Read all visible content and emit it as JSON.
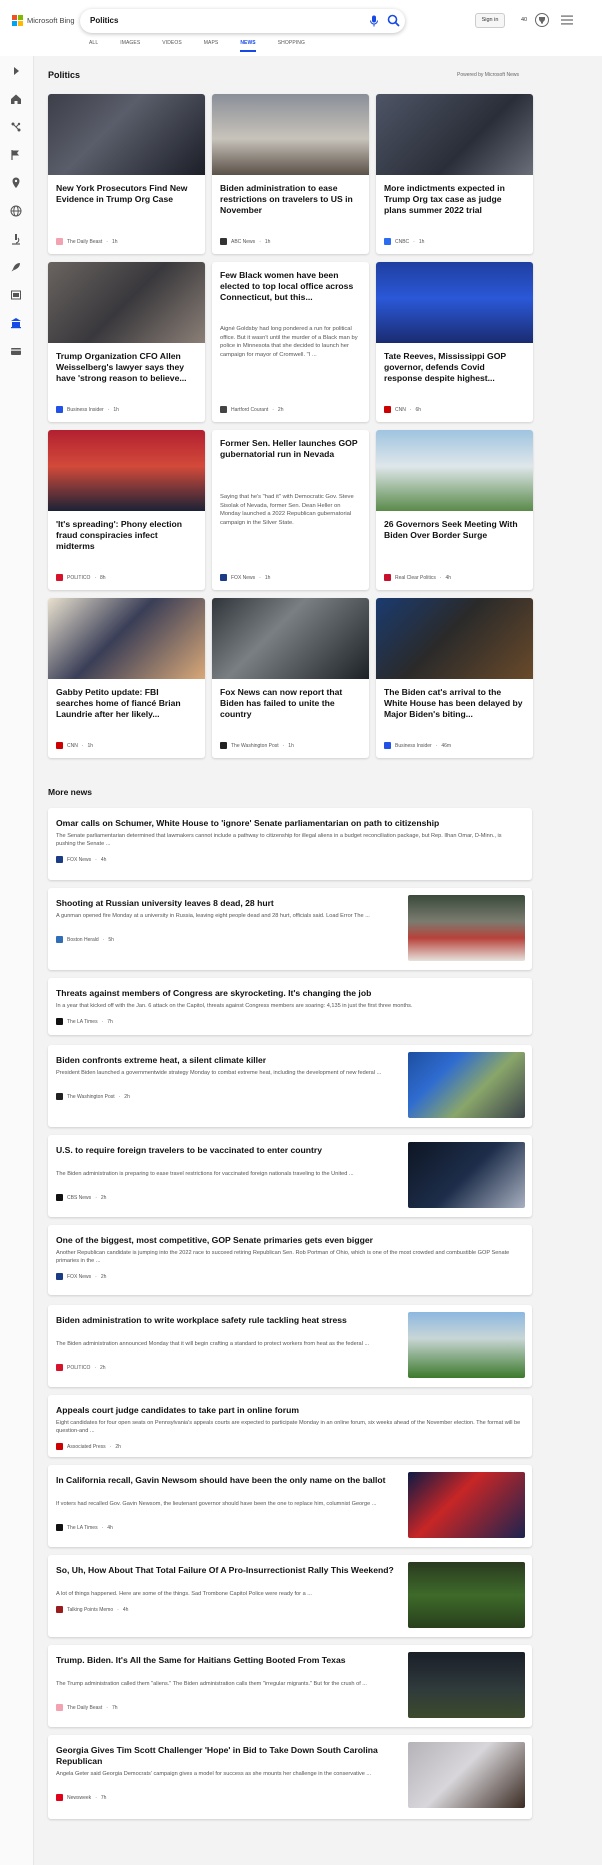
{
  "header": {
    "logo_text": "Microsoft Bing",
    "search_value": "Politics",
    "signin_label": "Sign in",
    "rewards_count": "40",
    "tabs": [
      {
        "label": "ALL"
      },
      {
        "label": "IMAGES"
      },
      {
        "label": "VIDEOS"
      },
      {
        "label": "MAPS"
      },
      {
        "label": "NEWS",
        "active": true
      },
      {
        "label": "SHOPPING"
      }
    ]
  },
  "sidebar": {
    "icons": [
      "expand-arrow-icon",
      "home-icon",
      "science-icon",
      "flag-icon",
      "location-pin-icon",
      "globe-icon",
      "microscope-icon",
      "rocket-icon",
      "film-icon",
      "building-icon",
      "card-icon"
    ]
  },
  "main": {
    "section_title": "Politics",
    "powered_by": "Powered by Microsoft News",
    "cards": [
      {
        "title": "New York Prosecutors Find New Evidence in Trump Org Case",
        "source": "The Daily Beast",
        "time": "1h"
      },
      {
        "title": "Biden administration to ease restrictions on travelers to US in November",
        "source": "ABC News",
        "time": "1h"
      },
      {
        "title": "More indictments expected in Trump Org tax case as judge plans summer 2022 trial",
        "source": "CNBC",
        "time": "1h"
      },
      {
        "title": "Trump Organization CFO Allen Weisselberg's lawyer says they have 'strong reason to believe...",
        "source": "Business Insider",
        "time": "1h"
      },
      {
        "title": "Few Black women have been elected to top local office across Connecticut, but this...",
        "snippet": "Aigné Goldsby had long pondered a run for political office. But it wasn't until the murder of a Black man by police in Minnesota that she decided to launch her campaign for mayor of Cromwell. \"I ...",
        "source": "Hartford Courant",
        "time": "2h"
      },
      {
        "title": "Tate Reeves, Mississippi GOP governor, defends Covid response despite highest...",
        "source": "CNN",
        "time": "6h"
      },
      {
        "title": "'It's spreading': Phony election fraud conspiracies infect midterms",
        "source": "POLITICO",
        "time": "8h"
      },
      {
        "title": "Former Sen. Heller launches GOP gubernatorial run in Nevada",
        "snippet": "Saying that he's \"had it\" with Democratic Gov. Steve Sisolak of Nevada, former Sen. Dean Heller on Monday launched a 2022 Republican gubernatorial campaign in the Silver State.",
        "source": "FOX News",
        "time": "1h"
      },
      {
        "title": "26 Governors Seek Meeting With Biden Over Border Surge",
        "source": "Real Clear Politics",
        "time": "4h"
      },
      {
        "title": "Gabby Petito update: FBI searches home of fiancé Brian Laundrie after her likely...",
        "source": "CNN",
        "time": "1h"
      },
      {
        "title": "Fox News can now report that Biden has failed to unite the country",
        "source": "The Washington Post",
        "time": "1h"
      },
      {
        "title": "The Biden cat's arrival to the White House has been delayed by Major Biden's biting...",
        "source": "Business Insider",
        "time": "46m"
      }
    ],
    "more_title": "More news",
    "more_news": [
      {
        "title": "Omar calls on Schumer, White House to 'ignore' Senate parliamentarian on path to citizenship",
        "snippet": "The Senate parliamentarian determined that lawmakers cannot include a pathway to citizenship for illegal aliens in a budget reconciliation package, but Rep. Ilhan Omar, D-Minn., is pushing the Senate ...",
        "source": "FOX News",
        "time": "4h"
      },
      {
        "title": "Shooting at Russian university leaves 8 dead, 28 hurt",
        "snippet": "A gunman opened fire Monday at a university in Russia, leaving eight people dead and 28 hurt, officials said. Load Error The ...",
        "source": "Boston Herald",
        "time": "5h"
      },
      {
        "title": "Threats against members of Congress are skyrocketing. It's changing the job",
        "snippet": "In a year that kicked off with the Jan. 6 attack on the Capitol, threats against Congress members are soaring: 4,135 in just the first three months.",
        "source": "The LA Times",
        "time": "7h"
      },
      {
        "title": "Biden confronts extreme heat, a silent climate killer",
        "snippet": "President Biden launched a governmentwide strategy Monday to combat extreme heat, including the development of new federal ...",
        "source": "The Washington Post",
        "time": "2h"
      },
      {
        "title": "U.S. to require foreign travelers to be vaccinated to enter country",
        "snippet": "The Biden administration is preparing to ease travel restrictions for vaccinated foreign nationals traveling to the United ...",
        "source": "CBS News",
        "time": "2h"
      },
      {
        "title": "One of the biggest, most competitive, GOP Senate primaries gets even bigger",
        "snippet": "Another Republican candidate is jumping into the 2022 race to succeed retiring Republican Sen. Rob Portman of Ohio, which is one of the most crowded and combustible GOP Senate primaries in the ...",
        "source": "FOX News",
        "time": "2h"
      },
      {
        "title": "Biden administration to write workplace safety rule tackling heat stress",
        "snippet": "The Biden administration announced Monday that it will begin crafting a standard to protect workers from heat as the federal ...",
        "source": "POLITICO",
        "time": "2h"
      },
      {
        "title": "Appeals court judge candidates to take part in online forum",
        "snippet": "Eight candidates for four open seats on Pennsylvania's appeals courts are expected to participate Monday in an online forum, six weeks ahead of the November election. The format will be question-and ...",
        "source": "Associated Press",
        "time": "2h"
      },
      {
        "title": "In California recall, Gavin Newsom should have been the only name on the ballot",
        "snippet": "If voters had recalled Gov. Gavin Newsom, the lieutenant governor should have been the one to replace him, columnist George ...",
        "source": "The LA Times",
        "time": "4h"
      },
      {
        "title": "So, Uh, How About That Total Failure Of A Pro-Insurrectionist Rally This Weekend?",
        "snippet": "A lot of things happened. Here are some of the things. Sad Trombone Capitol Police were ready for a ...",
        "source": "Talking Points Memo",
        "time": "4h"
      },
      {
        "title": "Trump. Biden. It's All the Same for Haitians Getting Booted From Texas",
        "snippet": "The Trump administration called them \"aliens.\" The Biden administration calls them \"irregular migrants.\" But for the crush of ...",
        "source": "The Daily Beast",
        "time": "7h"
      },
      {
        "title": "Georgia Gives Tim Scott Challenger 'Hope' in Bid to Take Down South Carolina Republican",
        "snippet": "Angela Geter said Georgia Democrats' campaign gives a model for success as she mounts her challenge in the conservative ...",
        "source": "Newsweek",
        "time": "7h"
      }
    ]
  },
  "colors": {
    "accent": "#174ae4",
    "logo_red": "#f25022",
    "logo_green": "#7fba00",
    "logo_blue": "#00a4ef",
    "logo_yellow": "#ffb900"
  }
}
